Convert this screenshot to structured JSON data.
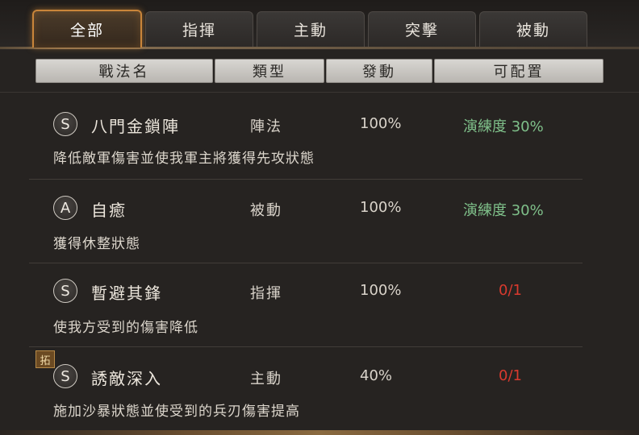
{
  "tabs": [
    {
      "label": "全部",
      "active": true
    },
    {
      "label": "指揮",
      "active": false
    },
    {
      "label": "主動",
      "active": false
    },
    {
      "label": "突擊",
      "active": false
    },
    {
      "label": "被動",
      "active": false
    }
  ],
  "columns": {
    "name": "戰法名",
    "type": "類型",
    "rate": "發動",
    "config": "可配置"
  },
  "colors": {
    "accent_orange": "#c9853a",
    "proficiency_green": "#7fc08a",
    "unavailable_red": "#d93a2e"
  },
  "skills": [
    {
      "grade": "S",
      "name": "八門金鎖陣",
      "type": "陣法",
      "rate": "100%",
      "config": "演練度 30%",
      "config_color": "#7fc08a",
      "desc": "降低敵軍傷害並使我軍主將獲得先攻狀態"
    },
    {
      "grade": "A",
      "name": "自癒",
      "type": "被動",
      "rate": "100%",
      "config": "演練度 30%",
      "config_color": "#7fc08a",
      "desc": "獲得休整狀態"
    },
    {
      "grade": "S",
      "name": "暫避其鋒",
      "type": "指揮",
      "rate": "100%",
      "config": "0/1",
      "config_color": "#d93a2e",
      "desc": "使我方受到的傷害降低"
    },
    {
      "grade": "S",
      "name": "誘敵深入",
      "type": "主動",
      "rate": "40%",
      "config": "0/1",
      "config_color": "#d93a2e",
      "desc": "施加沙暴狀態並使受到的兵刃傷害提高"
    }
  ],
  "badge": {
    "label": "拓"
  }
}
